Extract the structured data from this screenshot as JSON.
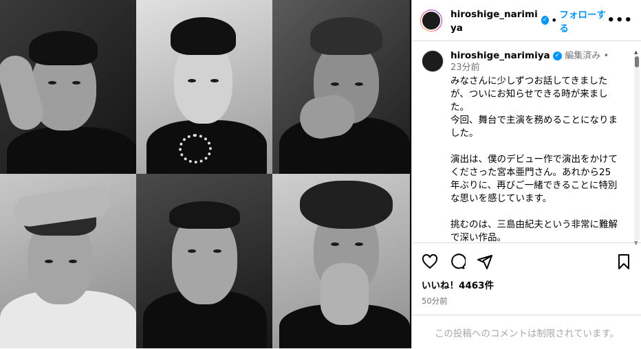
{
  "post": {
    "username": "hiroshige_narimiya",
    "verified_icon": "verified-badge-icon",
    "follow_label": "フォローする",
    "more_icon": "more-options-icon"
  },
  "caption": {
    "username": "hiroshige_narimiya",
    "edited": "編集済み",
    "time": "23分前",
    "text": "みなさんに少しずつお話してきましたが、ついにお知らせできる時が来ました。\n今回、舞台で主演を務めることになりました。\n\n演出は、僕のデビュー作で演出をかけてくださった宮本亜門さん。あれから25年ぶりに、再びご一緒できることに特別な思いを感じています。\n\n挑むのは、三島由紀夫という非常に難解で深い作品。\nだからこそ、皆さんに劇場で“生”の時"
  },
  "actions": {
    "like_icon": "heart-icon",
    "comment_icon": "comment-icon",
    "share_icon": "share-icon",
    "save_icon": "bookmark-icon",
    "likes_text": "いいね！4463件",
    "time_ago": "50分前"
  },
  "comment": {
    "disabled_text": "この投稿へのコメントは制限されています。"
  },
  "colors": {
    "accent": "#0095f6",
    "muted": "#737373",
    "border": "#dbdbdb"
  }
}
